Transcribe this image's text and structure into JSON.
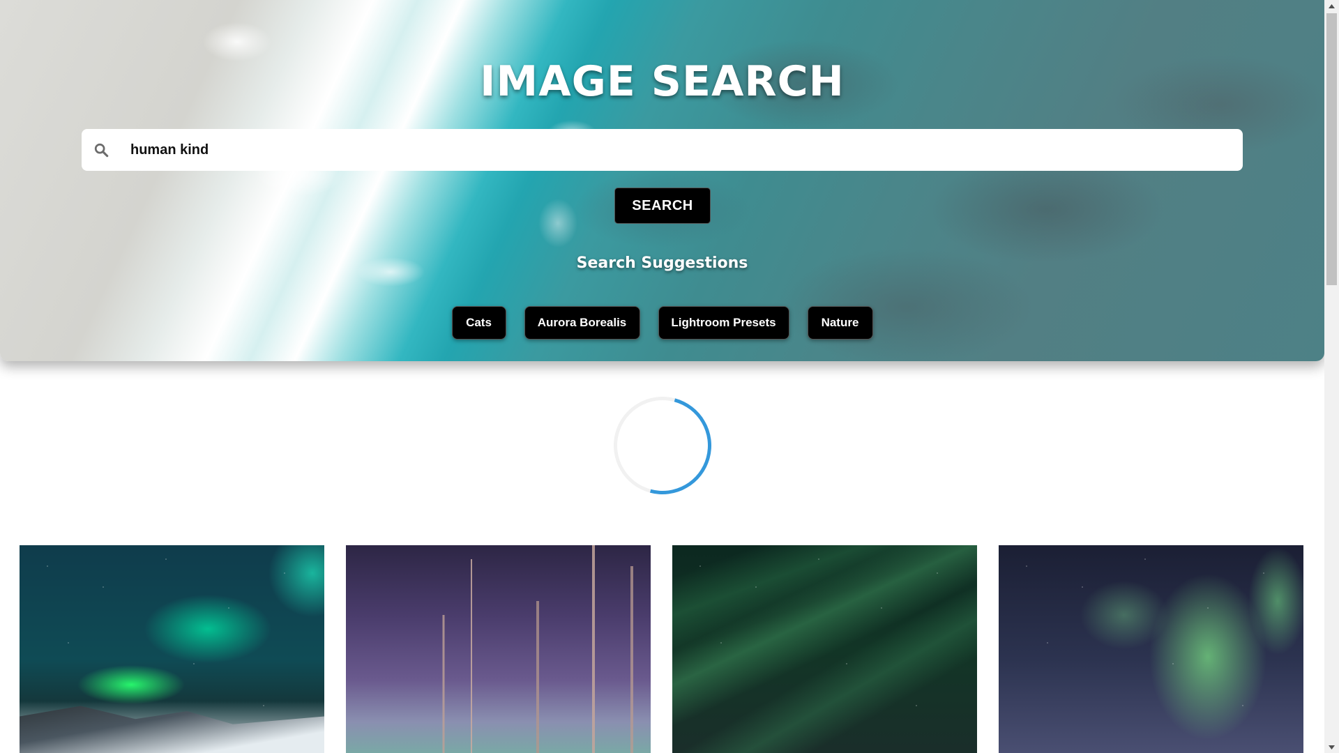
{
  "header": {
    "title": "IMAGE SEARCH"
  },
  "search": {
    "value": "human kind",
    "placeholder": "",
    "button_label": "SEARCH"
  },
  "suggestions": {
    "heading": "Search Suggestions",
    "items": [
      "Cats",
      "Aurora Borealis",
      "Lightroom Presets",
      "Nature"
    ]
  },
  "loading": {
    "spinner_color": "#3498db",
    "track_color": "#f1f1f1"
  },
  "results": {
    "count_visible": 4
  },
  "colors": {
    "button_bg": "#000000",
    "button_text": "#ffffff",
    "page_bg": "#ffffff"
  }
}
